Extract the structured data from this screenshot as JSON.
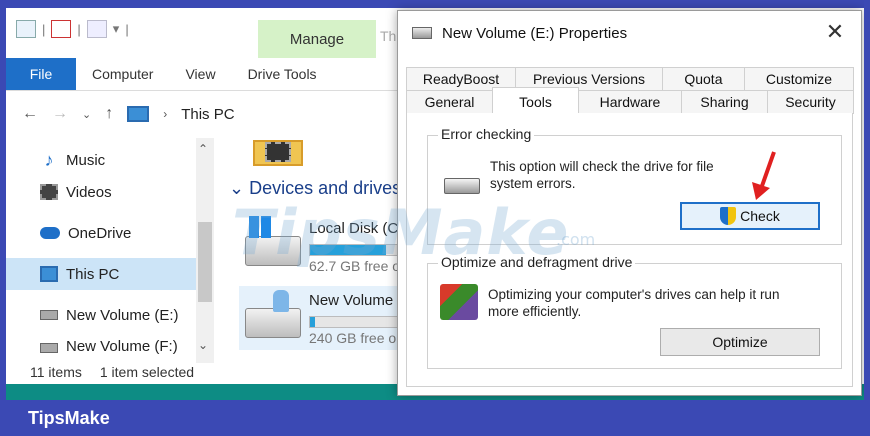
{
  "explorer": {
    "qat_separator": "|",
    "qat_dropdown": "▾",
    "context_tab": "Manage",
    "context_tab_partial": "Th",
    "ribbon_tabs": [
      "File",
      "Computer",
      "View",
      "Drive Tools"
    ],
    "address_crumb": "This PC",
    "nav_items": [
      "Music",
      "Videos",
      "OneDrive",
      "This PC",
      "New Volume (E:)",
      "New Volume (F:)"
    ],
    "group_header": "Devices and drives",
    "drives": [
      {
        "name": "Local Disk (C:",
        "free": "62.7 GB free o",
        "used_fraction": 0.7
      },
      {
        "name": "New Volume",
        "free": "240 GB free o",
        "used_fraction": 0.05
      }
    ],
    "status_items": "11 items",
    "status_selected": "1 item selected"
  },
  "dialog": {
    "title": "New Volume (E:) Properties",
    "close_glyph": "✕",
    "tabs_row1": [
      "ReadyBoost",
      "Previous Versions",
      "Quota",
      "Customize"
    ],
    "tabs_row2": [
      "General",
      "Tools",
      "Hardware",
      "Sharing",
      "Security"
    ],
    "active_tab": "Tools",
    "error_checking": {
      "label": "Error checking",
      "description_line1": "This option will check the drive for file",
      "description_line2": "system errors.",
      "button": "Check"
    },
    "optimize": {
      "label": "Optimize and defragment drive",
      "description_line1": "Optimizing your computer's drives can help it run",
      "description_line2": "more efficiently.",
      "button": "Optimize"
    }
  },
  "watermark": {
    "text": "TipsMake",
    "suffix": ".com"
  },
  "footer": {
    "label": "TipsMake"
  },
  "colors": {
    "frame": "#3b49b4",
    "file_tab": "#1e6fc8",
    "manage_tab": "#d6f2c8",
    "selected_nav": "#cce4f7",
    "arrow": "#e02020"
  }
}
